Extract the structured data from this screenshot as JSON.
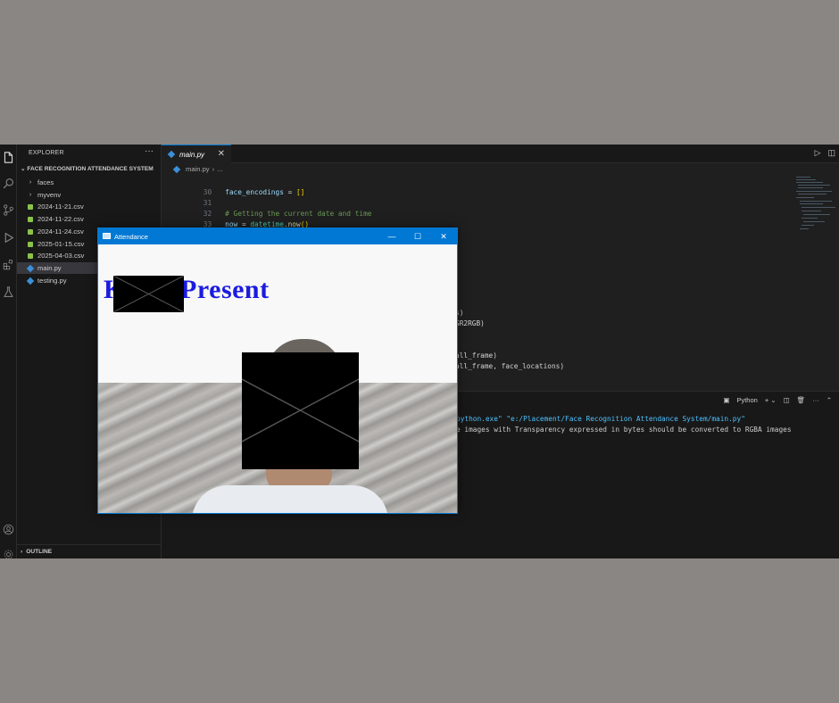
{
  "explorer": {
    "header": "EXPLORER",
    "more": "···",
    "project": "FACE RECOGNITION ATTENDANCE SYSTEM",
    "items": [
      {
        "label": "faces",
        "kind": "folder"
      },
      {
        "label": "myvenv",
        "kind": "folder"
      },
      {
        "label": "2024-11-21.csv",
        "kind": "csv"
      },
      {
        "label": "2024-11-22.csv",
        "kind": "csv"
      },
      {
        "label": "2024-11-24.csv",
        "kind": "csv"
      },
      {
        "label": "2025-01-15.csv",
        "kind": "csv"
      },
      {
        "label": "2025-04-03.csv",
        "kind": "csv"
      },
      {
        "label": "main.py",
        "kind": "python",
        "selected": true
      },
      {
        "label": "testing.py",
        "kind": "python"
      }
    ],
    "outline": "OUTLINE"
  },
  "editor": {
    "tab_label": "main.py",
    "tab_close": "✕",
    "breadcrumb": {
      "file": "main.py",
      "separator": "›",
      "rest": "..."
    },
    "lines": [
      {
        "num": "30",
        "var": "face_encodings",
        "op": " = ",
        "value": "[]"
      },
      {
        "num": "31",
        "var": "",
        "op": "",
        "value": ""
      },
      {
        "num": "32",
        "comment": "# Getting the current date and time"
      },
      {
        "num": "33",
        "var": "now",
        "op": " = ",
        "cls": "datetime",
        "fn": ".now",
        "value": "()"
      }
    ],
    "fragments": [
      "s)",
      "GR2RGB)",
      "all_frame)",
      "all_frame, face_locations)"
    ]
  },
  "terminal": {
    "shell_label": "Python",
    "command": "python.exe\" \"e:/Placement/Face Recognition Attendance System/main.py\"",
    "warning": "e images with Transparency expressed in bytes should be converted to RGBA images"
  },
  "window": {
    "title": "Attendance",
    "overlay_text": "K    n is Present"
  },
  "icons": {
    "activity": [
      "files-icon",
      "search-icon",
      "source-control-icon",
      "run-debug-icon",
      "extensions-icon",
      "testing-icon",
      "account-icon",
      "settings-icon"
    ]
  },
  "colors": {
    "accent": "#0078d4",
    "overlay_text": "#1b1bdf",
    "editor_bg": "#1f1f1f"
  }
}
